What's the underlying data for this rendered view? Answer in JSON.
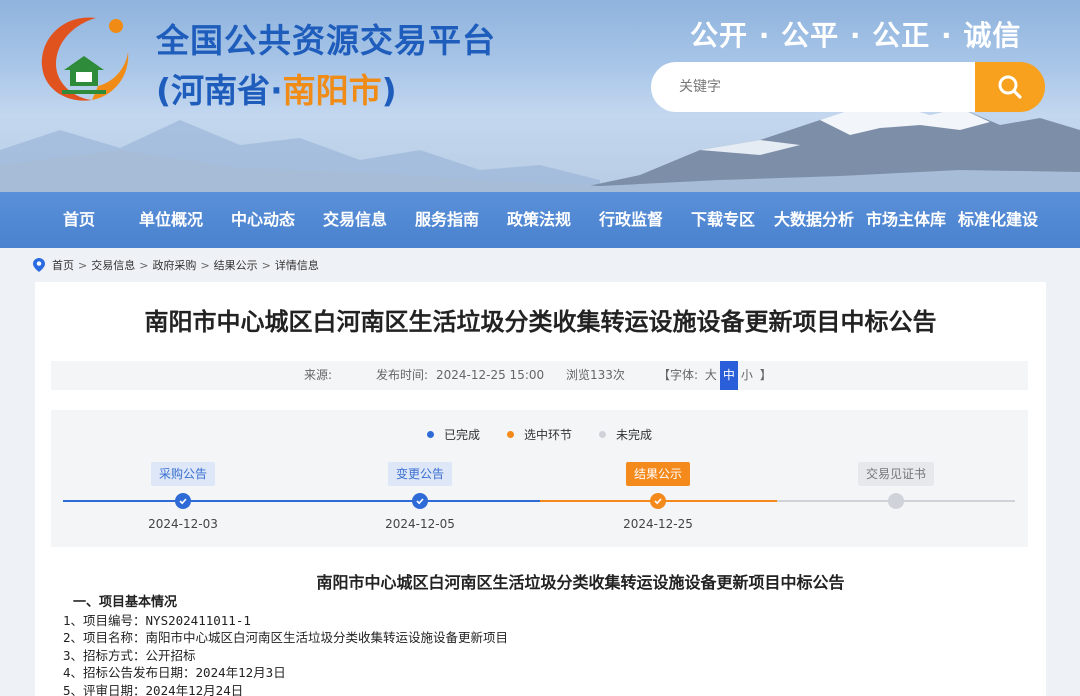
{
  "header": {
    "title_line1": "全国公共资源交易平台",
    "title_line2_prefix": "(河南省·",
    "title_line2_city": "南阳市",
    "title_line2_suffix": ")",
    "slogan": "公开 · 公平 · 公正 · 诚信",
    "search_placeholder": "关键字",
    "search_icon": "search-icon",
    "logo_icon": "platform-logo-icon",
    "colors": {
      "title": "#1f5dbc",
      "accent": "#f08b16",
      "search_button": "#f7a11e"
    }
  },
  "nav": {
    "items": [
      "首页",
      "单位概况",
      "中心动态",
      "交易信息",
      "服务指南",
      "政策法规",
      "行政监督",
      "下载专区",
      "大数据分析",
      "市场主体库",
      "标准化建设"
    ],
    "color": "#4a82cf"
  },
  "breadcrumb": {
    "icon": "location-pin-icon",
    "items": [
      "首页",
      "交易信息",
      "政府采购",
      "结果公示",
      "详情信息"
    ],
    "separator": ">"
  },
  "article": {
    "title": "南阳市中心城区白河南区生活垃圾分类收集转运设施设备更新项目中标公告",
    "meta": {
      "source_label": "来源:",
      "publish_label": "发布时间:",
      "publish_time": "2024-12-25 15:00",
      "views": "浏览133次",
      "font_label": "【字体:",
      "font_sizes": [
        "大",
        "中",
        "小"
      ],
      "font_active": "中",
      "font_close": "】"
    }
  },
  "progress": {
    "legend": [
      {
        "label": "已完成",
        "color": "#2f6bd7"
      },
      {
        "label": "选中环节",
        "color": "#f4891c"
      },
      {
        "label": "未完成",
        "color": "#cfd2d8"
      }
    ],
    "steps": [
      {
        "label": "采购公告",
        "date": "2024-12-03",
        "status": "done"
      },
      {
        "label": "变更公告",
        "date": "2024-12-05",
        "status": "done"
      },
      {
        "label": "结果公示",
        "date": "2024-12-25",
        "status": "current"
      },
      {
        "label": "交易见证书",
        "date": "",
        "status": "todo"
      }
    ]
  },
  "document": {
    "title": "南阳市中心城区白河南区生活垃圾分类收集转运设施设备更新项目中标公告",
    "section1_heading": "一、项目基本情况",
    "lines": [
      "1、项目编号：NYS202411011-1",
      "2、项目名称：南阳市中心城区白河南区生活垃圾分类收集转运设施设备更新项目",
      "3、招标方式：公开招标",
      "4、招标公告发布日期：2024年12月3日",
      "5、评审日期：2024年12月24日"
    ]
  }
}
